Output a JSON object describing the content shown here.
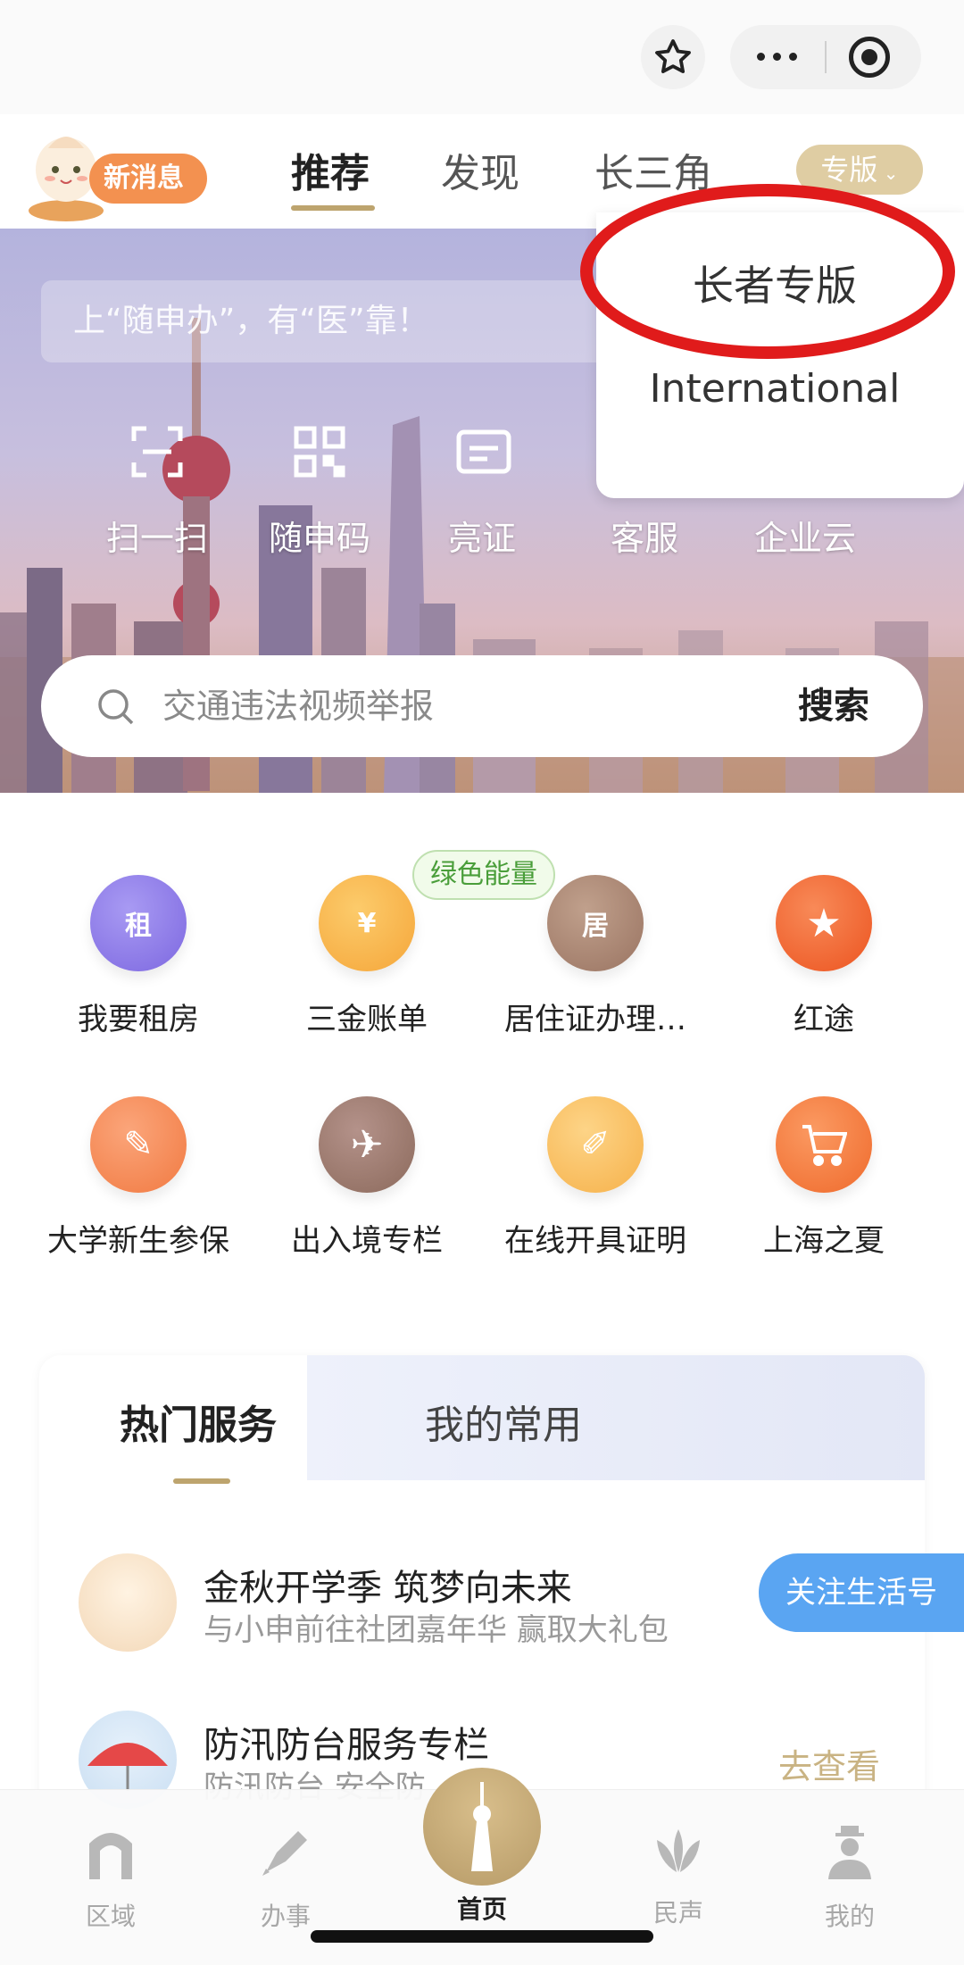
{
  "nav": {
    "message_badge": "新消息",
    "tabs": [
      "推荐",
      "发现",
      "长三角"
    ],
    "edition_button": "专版"
  },
  "dropdown": {
    "items": [
      "长者专版",
      "International"
    ]
  },
  "hero": {
    "hint": "上“随申办”，有“医”靠！",
    "quick_actions": [
      {
        "label": "扫一扫",
        "icon": "scan-icon"
      },
      {
        "label": "随申码",
        "icon": "qr-code-icon"
      },
      {
        "label": "亮证",
        "icon": "card-icon"
      },
      {
        "label": "客服",
        "icon": "service-icon"
      },
      {
        "label": "企业云",
        "icon": "cloud-icon"
      }
    ],
    "search_placeholder": "交通违法视频举报",
    "search_button": "搜索"
  },
  "services": [
    {
      "label": "我要租房",
      "icon": "rent-house-icon",
      "glyph": "租",
      "color": "#8f7de9"
    },
    {
      "label": "三金账单",
      "icon": "fund-bill-icon",
      "glyph": "¥",
      "color": "#f7b24a",
      "badge": "绿色能量"
    },
    {
      "label": "居住证办理…",
      "icon": "residence-permit-icon",
      "glyph": "居",
      "color": "#a8806a"
    },
    {
      "label": "红途",
      "icon": "red-star-icon",
      "glyph": "★",
      "color": "#f0662e"
    },
    {
      "label": "大学新生参保",
      "icon": "insurance-icon",
      "glyph": "✎",
      "color": "#f48a54"
    },
    {
      "label": "出入境专栏",
      "icon": "airplane-icon",
      "glyph": "✈",
      "color": "#9c7766"
    },
    {
      "label": "在线开具证明",
      "icon": "certificate-icon",
      "glyph": "✐",
      "color": "#f8be5a"
    },
    {
      "label": "上海之夏",
      "icon": "shopping-cart-icon",
      "glyph": "🛒",
      "color": "#f57b3e"
    }
  ],
  "hot_card": {
    "tabs": [
      "热门服务",
      "我的常用"
    ],
    "rows": [
      {
        "title": "金秋开学季 筑梦向未来",
        "subtitle": "与小申前往社团嘉年华 赢取大礼包"
      },
      {
        "title": "防汛防台服务专栏",
        "subtitle": "防汛防台 安全防"
      }
    ],
    "follow_button": "关注生活号",
    "goto_link": "去查看"
  },
  "tabbar": {
    "items": [
      {
        "label": "区域",
        "icon": "region-icon"
      },
      {
        "label": "办事",
        "icon": "pen-icon"
      },
      {
        "label": "首页",
        "icon": "home-tower-icon"
      },
      {
        "label": "民声",
        "icon": "lotus-icon"
      },
      {
        "label": "我的",
        "icon": "profile-icon"
      }
    ]
  }
}
